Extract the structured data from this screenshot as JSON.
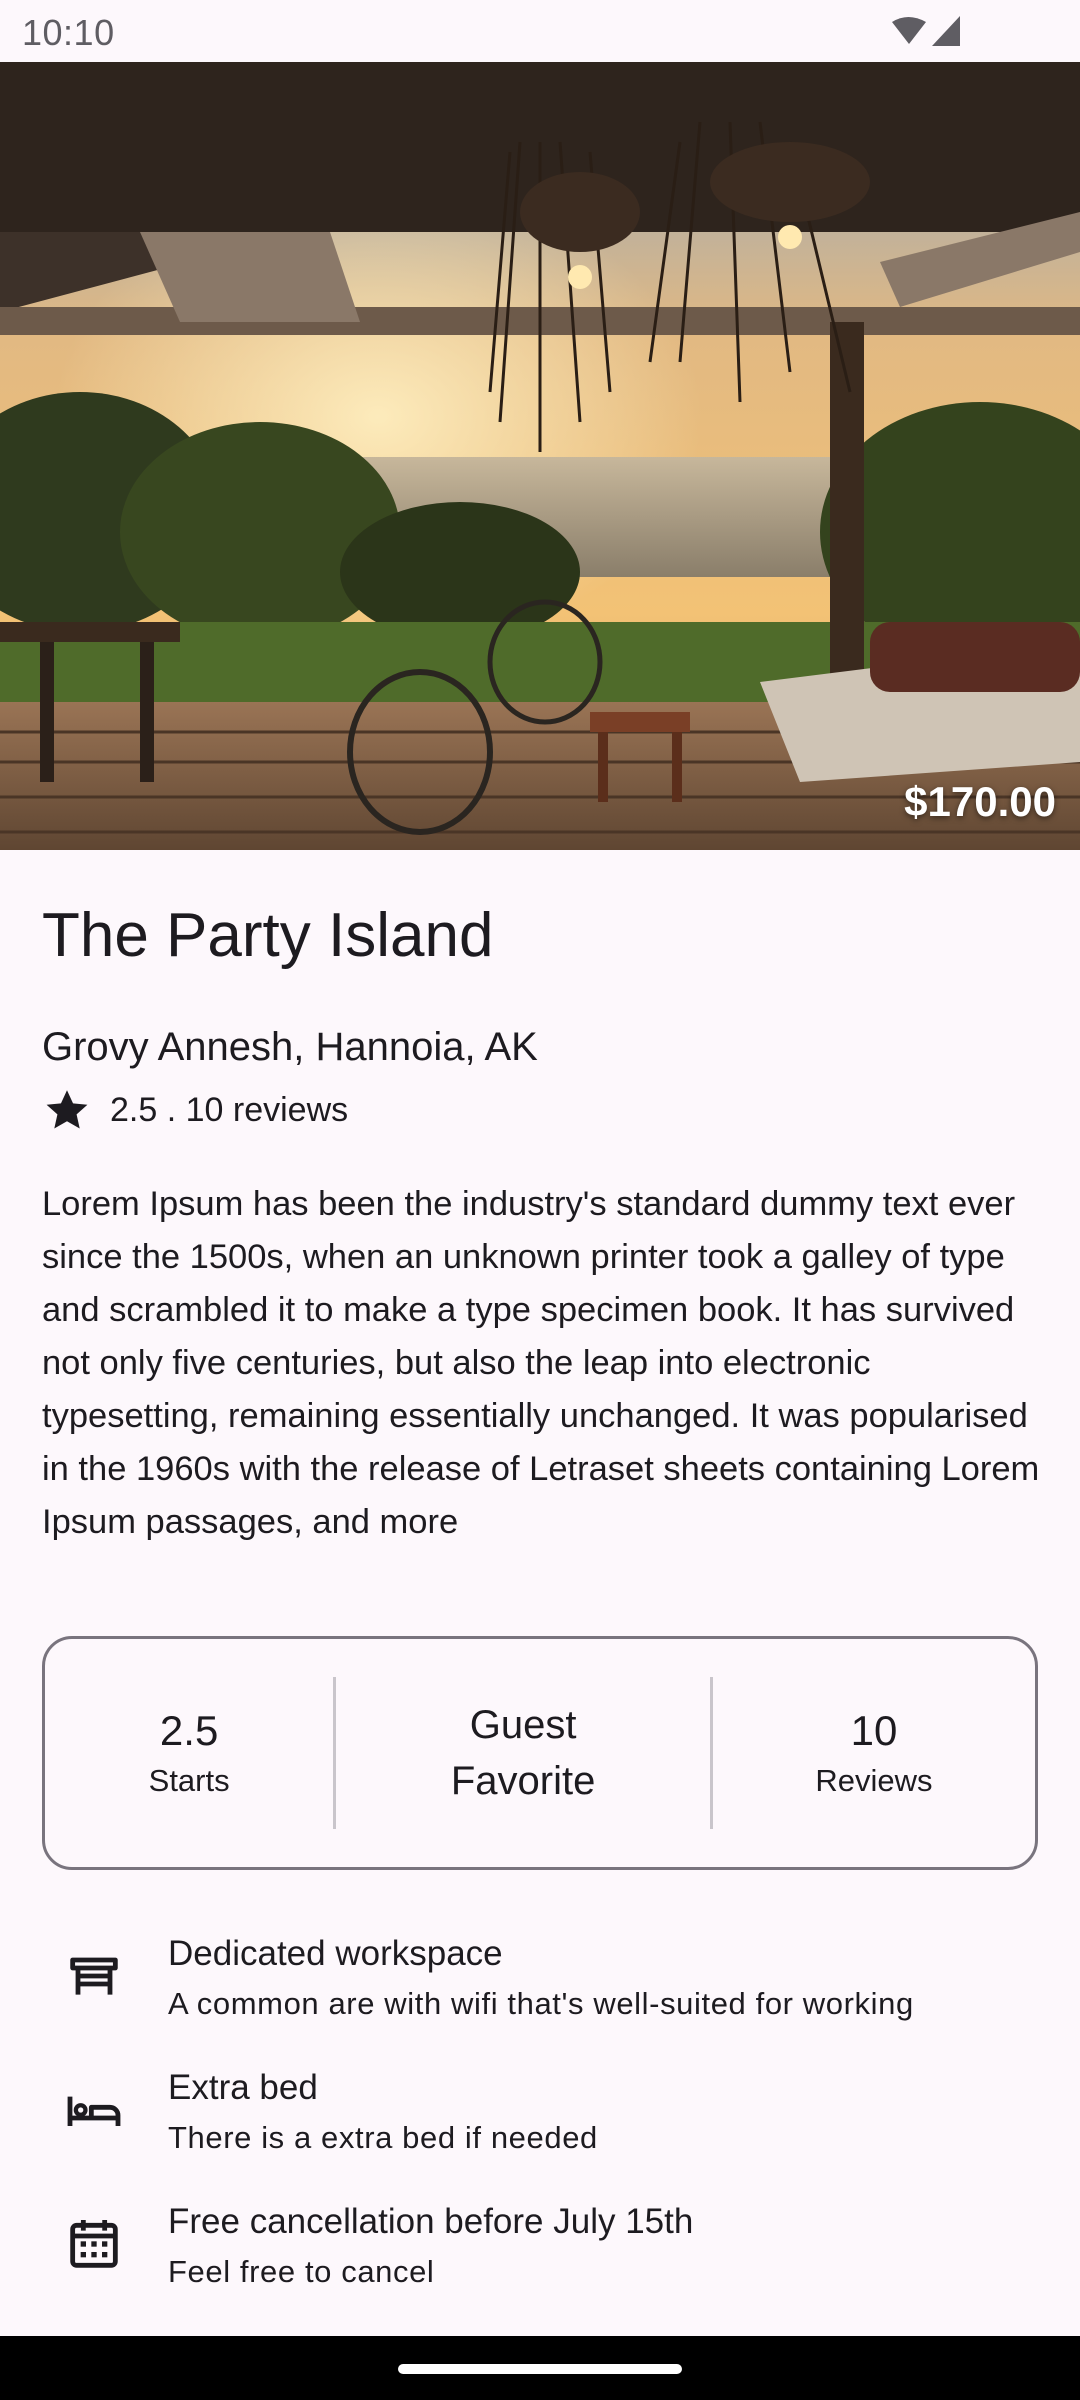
{
  "status_bar": {
    "time": "10:10"
  },
  "listing": {
    "price": "$170.00",
    "title": "The Party Island",
    "location": "Grovy Annesh, Hannoia, AK",
    "rating_text": "2.5 . 10 reviews",
    "description": "Lorem Ipsum has been the industry's standard dummy text ever since the 1500s, when an unknown printer took a galley of type and scrambled it to make a type specimen book. It has survived not only five centuries, but also the leap into electronic typesetting, remaining essentially unchanged. It was popularised in the 1960s with the release of Letraset sheets containing Lorem Ipsum passages, and more"
  },
  "stats": {
    "rating_value": "2.5",
    "rating_label": "Starts",
    "badge_line1": "Guest",
    "badge_line2": "Favorite",
    "reviews_value": "10",
    "reviews_label": "Reviews"
  },
  "amenities": [
    {
      "icon": "desk-icon",
      "title": "Dedicated workspace",
      "subtitle": "A common are with wifi that's well-suited for working"
    },
    {
      "icon": "bed-icon",
      "title": "Extra bed",
      "subtitle": "There is a extra bed if needed"
    },
    {
      "icon": "calendar-icon",
      "title": "Free cancellation before July 15th",
      "subtitle": "Feel free to cancel"
    }
  ],
  "colors": {
    "background": "#fdf8fc",
    "text": "#1d1b20",
    "outline": "#79747e"
  }
}
